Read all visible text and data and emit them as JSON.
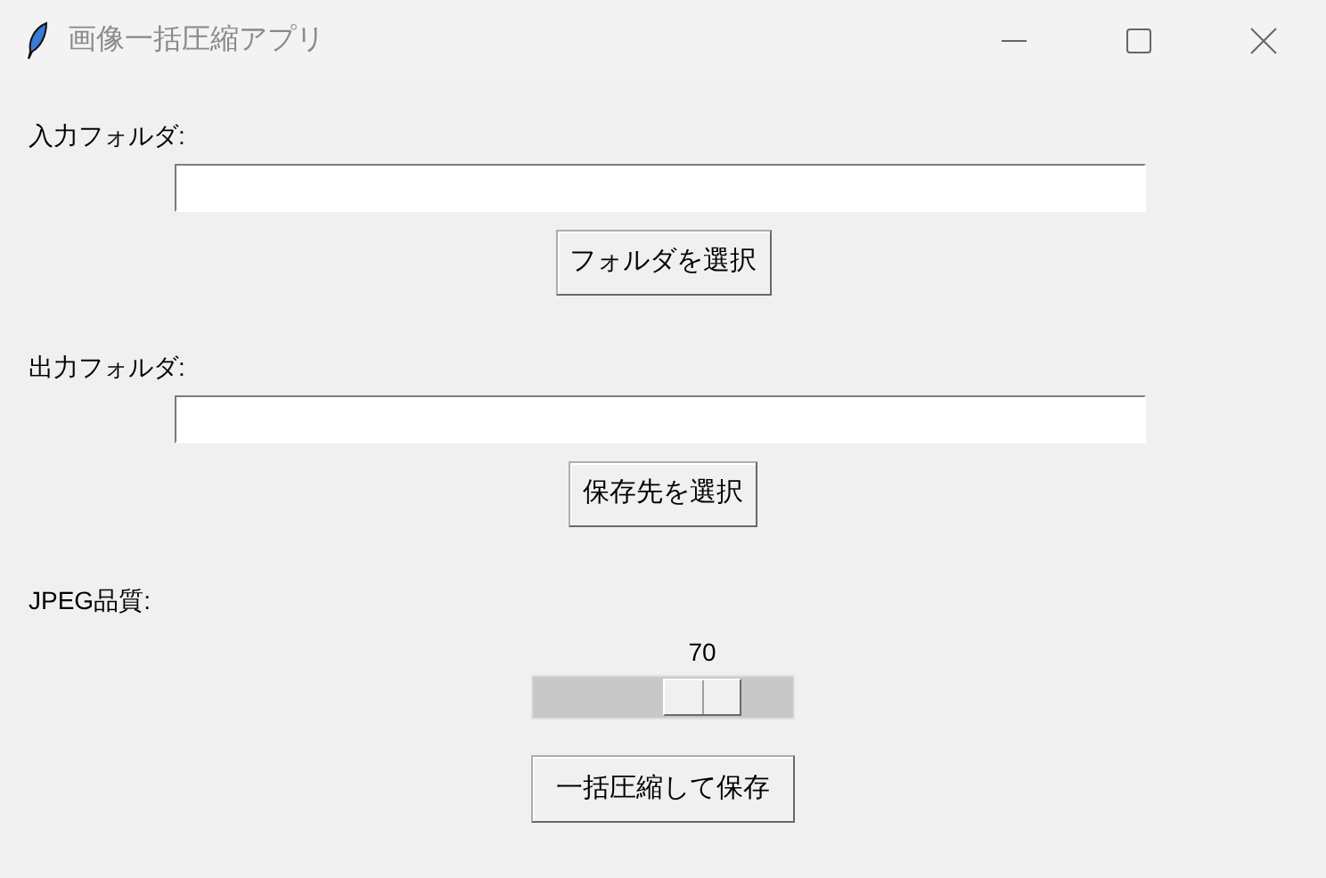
{
  "window": {
    "title": "画像一括圧縮アプリ"
  },
  "input_folder": {
    "label": "入力フォルダ:",
    "button": "フォルダを選択"
  },
  "output_folder": {
    "label": "出力フォルダ:",
    "button": "保存先を選択"
  },
  "quality": {
    "label": "JPEG品質:",
    "reading": "70",
    "level": 0.7
  },
  "action_button": "一括圧縮して保存"
}
